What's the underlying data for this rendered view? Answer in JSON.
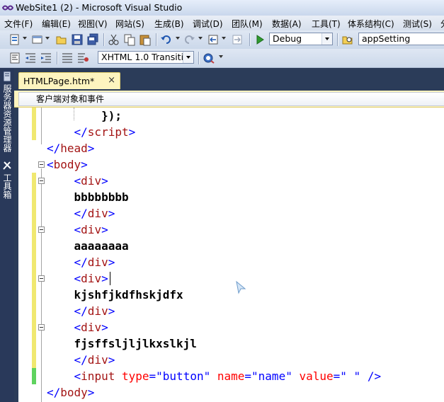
{
  "window": {
    "title": "WebSite1 (2) - Microsoft Visual Studio"
  },
  "menu": [
    "文件(F)",
    "编辑(E)",
    "视图(V)",
    "网站(S)",
    "生成(B)",
    "调试(D)",
    "团队(M)",
    "数据(A)",
    "工具(T)",
    "体系结构(C)",
    "测试(S)",
    "分"
  ],
  "toolbar": {
    "config_value": "Debug",
    "find_value": "appSetting",
    "doctype_value": "XHTML 1.0 Transitic"
  },
  "side_panels": [
    "服务器资源管理器",
    "工具箱"
  ],
  "document_tab": {
    "label": "HTMLPage.htm*",
    "close": "×"
  },
  "navbar": {
    "object_events": "客户端对象和事件"
  },
  "code": {
    "l1": "});",
    "l2_open": "</",
    "l2_tag": "script",
    "l2_close": ">",
    "head_close_tag": "head",
    "body_tag": "body",
    "div_tag": "div",
    "text1": "bbbbbbbb",
    "text2": "aaaaaaaa",
    "text3": "kjshfjkdfhskjdfx",
    "text4": "fjsffsljljlkxslkjl",
    "input_tag": "input",
    "attr_type": "type",
    "val_type": "\"button\"",
    "attr_name": "name",
    "val_name": "\"name\"",
    "attr_value": "value",
    "val_value": "\" \"",
    "selfclose": " />",
    "eq": "=",
    "lt": "<",
    "lt_slash": "</",
    "gt": ">"
  },
  "colors": {
    "tag": "#a31515",
    "bracket": "#0000ff",
    "attr": "#ff0000",
    "unsaved_change": "#f0e870",
    "saved_change": "#5fd35f"
  }
}
